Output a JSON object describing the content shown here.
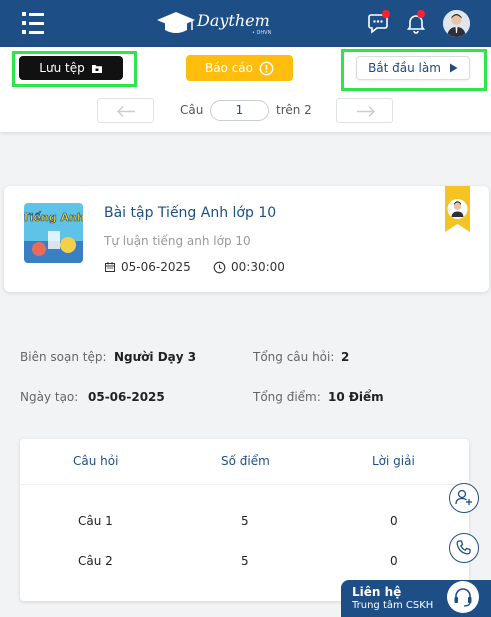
{
  "header": {
    "brand": "Daythem",
    "brand_sub": "• DHVN",
    "icons": [
      "menu-icon",
      "chat-icon",
      "bell-icon",
      "user-avatar"
    ]
  },
  "toolbar": {
    "save_label": "Lưu tệp",
    "report_label": "Báo cáo",
    "start_label": "Bắt đầu làm",
    "pager": {
      "question_label": "Câu",
      "current": "1",
      "of_label": "trên 2"
    }
  },
  "card": {
    "cover_text": "Tiếng Anh",
    "title": "Bài tập Tiếng Anh lớp 10",
    "subtitle": "Tự luận tiếng anh lớp 10",
    "date": "05-06-2025",
    "duration": "00:30:00"
  },
  "info": {
    "author_label": "Biên soạn tệp:",
    "author_value": "Người Dạy 3",
    "total_questions_label": "Tổng câu hỏi:",
    "total_questions_value": "2",
    "created_label": "Ngày tạo:",
    "created_value": "05-06-2025",
    "total_score_label": "Tổng điểm:",
    "total_score_value": "10 Điểm"
  },
  "table": {
    "headers": [
      "Câu hỏi",
      "Số điểm",
      "Lời giải"
    ],
    "rows": [
      [
        "Câu 1",
        "5",
        "0"
      ],
      [
        "Câu 2",
        "5",
        "0"
      ]
    ]
  },
  "contact": {
    "title": "Liên hệ",
    "subtitle": "Trung tâm CSKH"
  },
  "colors": {
    "primary": "#1d4f86",
    "report": "#ffbd0e",
    "highlight": "#2ee64c",
    "notify": "#ff1f2e"
  }
}
